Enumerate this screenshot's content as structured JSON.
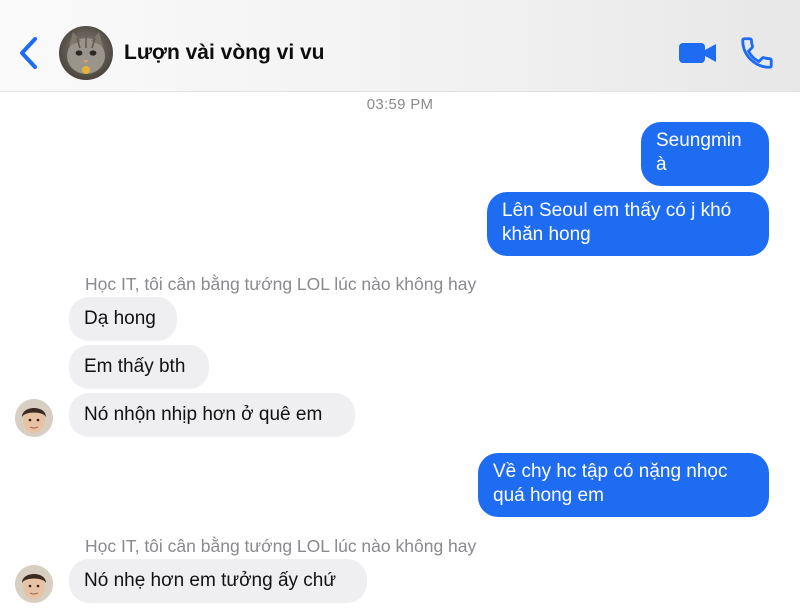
{
  "header": {
    "title": "Lượn vài vòng vi vu",
    "accent": "#1e6cf2"
  },
  "timestamp": "03:59 PM",
  "messages": {
    "out1": "Seungmin à",
    "out2": "Lên Seoul em thấy có j khó khăn hong",
    "group1": {
      "sender": "Học IT, tôi cân bằng tướng LOL lúc nào không hay",
      "m1": "Dạ hong",
      "m2": "Em thấy bth",
      "m3": "Nó nhộn nhịp hơn ở quê em"
    },
    "out3": "Về chy hc tập có nặng nhọc quá hong em",
    "group2": {
      "sender": "Học IT, tôi cân bằng tướng LOL lúc nào không hay",
      "m1": "Nó nhẹ hơn em tưởng ấy chứ"
    }
  },
  "colors": {
    "outgoing_bubble": "#1e6cf2",
    "incoming_bubble": "#efeff2",
    "meta_text": "#8a8a8e"
  },
  "icons": {
    "back": "chevron-left-icon",
    "video": "video-camera-icon",
    "call": "phone-icon"
  }
}
